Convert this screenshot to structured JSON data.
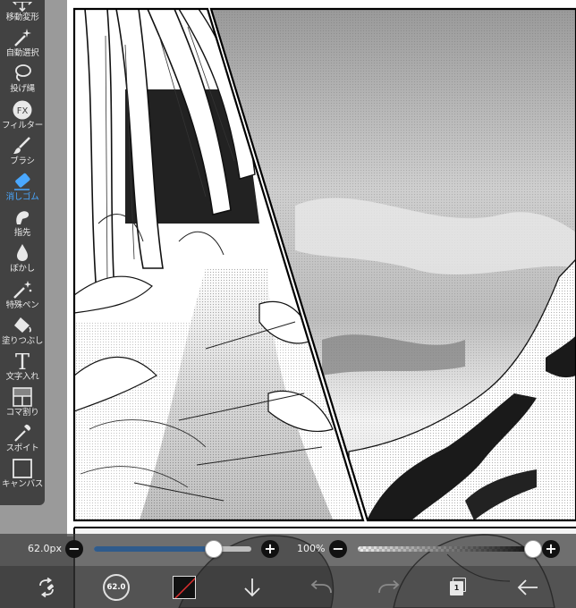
{
  "toolbar": {
    "items": [
      {
        "id": "move",
        "label": "移動変形",
        "icon": "move-arrows-icon"
      },
      {
        "id": "auto-select",
        "label": "自動選択",
        "icon": "magic-wand-icon"
      },
      {
        "id": "lasso",
        "label": "投げ縄",
        "icon": "lasso-icon"
      },
      {
        "id": "filter",
        "label": "フィルター",
        "icon": "fx-icon",
        "icon_text": "FX"
      },
      {
        "id": "brush",
        "label": "ブラシ",
        "icon": "brush-icon"
      },
      {
        "id": "eraser",
        "label": "消しゴム",
        "icon": "eraser-icon",
        "active": true
      },
      {
        "id": "finger",
        "label": "指先",
        "icon": "finger-icon"
      },
      {
        "id": "blur",
        "label": "ぼかし",
        "icon": "droplet-icon"
      },
      {
        "id": "special-pen",
        "label": "特殊ペン",
        "icon": "sparkle-pen-icon"
      },
      {
        "id": "fill",
        "label": "塗りつぶし",
        "icon": "fill-bucket-icon"
      },
      {
        "id": "text",
        "label": "文字入れ",
        "icon": "text-icon",
        "icon_text": "T"
      },
      {
        "id": "frame",
        "label": "コマ割り",
        "icon": "frame-divider-icon"
      },
      {
        "id": "eyedropper",
        "label": "スポイト",
        "icon": "eyedropper-icon"
      },
      {
        "id": "canvas",
        "label": "キャンバス",
        "icon": "canvas-icon"
      }
    ],
    "active_color": "#4aa8ff"
  },
  "sliders": {
    "brush_size": {
      "label": "62.0px",
      "level": 0.76,
      "fill_color": "#2f5b8c"
    },
    "opacity": {
      "label": "100%",
      "level": 1.0
    }
  },
  "bottom_bar": {
    "brush_preview_label": "62.0",
    "color": "#111111",
    "layer_count": "1",
    "icons": [
      "swap-tool-icon",
      "brush-size-icon",
      "color-swatch-icon",
      "download-arrow-icon",
      "undo-icon",
      "redo-icon",
      "layers-icon",
      "back-arrow-icon"
    ]
  }
}
